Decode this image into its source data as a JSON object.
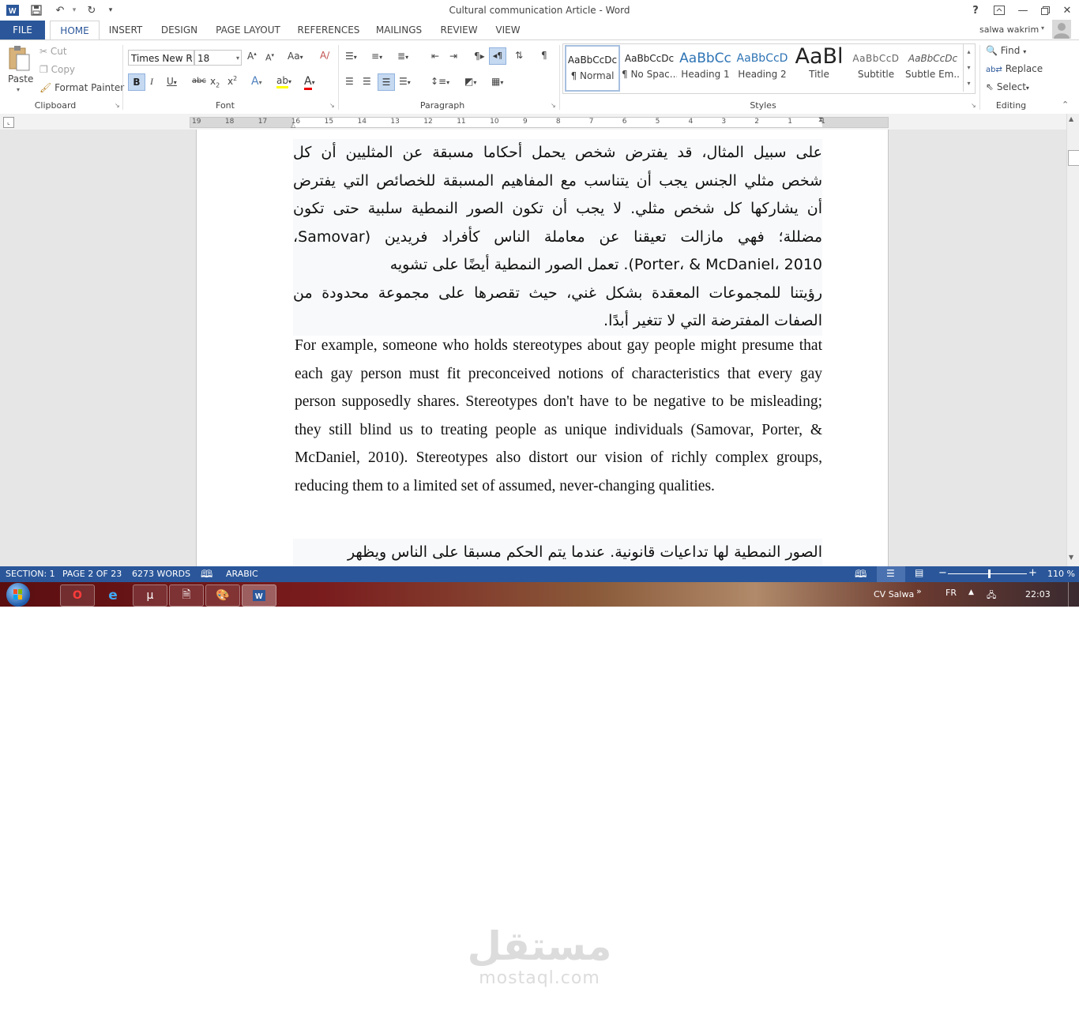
{
  "window": {
    "title": "Cultural communication Article - Word",
    "help": "?"
  },
  "quick_access": {
    "app_icon": "word-icon",
    "save_icon": "save-icon",
    "undo_icon": "undo-icon",
    "redo_icon": "redo-icon"
  },
  "tabs": [
    "FILE",
    "HOME",
    "INSERT",
    "DESIGN",
    "PAGE LAYOUT",
    "REFERENCES",
    "MAILINGS",
    "REVIEW",
    "VIEW"
  ],
  "user": "salwa wakrim",
  "ribbon": {
    "clipboard": {
      "paste": "Paste",
      "cut": "Cut",
      "copy": "Copy",
      "format_painter": "Format Painter",
      "group_label": "Clipboard"
    },
    "font": {
      "font_name": "Times New R",
      "font_size": "18",
      "group_label": "Font"
    },
    "paragraph": {
      "group_label": "Paragraph"
    },
    "styles": {
      "items": [
        {
          "sample": "AaBbCcDc",
          "name": "¶ Normal"
        },
        {
          "sample": "AaBbCcDc",
          "name": "¶ No Spac..."
        },
        {
          "sample": "AaBbCc",
          "name": "Heading 1"
        },
        {
          "sample": "AaBbCcD",
          "name": "Heading 2"
        },
        {
          "sample": "AaBl",
          "name": "Title"
        },
        {
          "sample": "AaBbCcD",
          "name": "Subtitle"
        },
        {
          "sample": "AaBbCcDc",
          "name": "Subtle Em..."
        }
      ],
      "group_label": "Styles"
    },
    "editing": {
      "find": "Find",
      "replace": "Replace",
      "select": "Select",
      "group_label": "Editing"
    }
  },
  "ruler": {
    "numbers": [
      "19",
      "18",
      "17",
      "16",
      "15",
      "14",
      "13",
      "12",
      "11",
      "10",
      "9",
      "8",
      "7",
      "6",
      "5",
      "4",
      "3",
      "2",
      "1",
      "1"
    ]
  },
  "document": {
    "arabic_paragraph_lines": [
      "على سبيل المثال، قد يفترض شخص يحمل أحكاما مسبقة عن المثليين أن كل",
      "شخص مثلي الجنس يجب أن يتناسب مع المفاهيم المسبقة للخصائص التي يفترض",
      "أن يشاركها كل شخص مثلي. لا يجب أن تكون الصور النمطية سلبية حتى تكون",
      "مضللة؛ فهي مازالت تعيقنا عن معاملة الناس كأفراد فريدين (Samovar،",
      "Porter، & McDaniel، 2010). تعمل الصور النمطية أيضًا على تشويه",
      "رؤيتنا للمجموعات المعقدة بشكل غني، حيث تقصرها على مجموعة محدودة من",
      "الصفات المفترضة التي لا تتغير أبدًا."
    ],
    "english_paragraph": "For example, someone who holds stereotypes about gay people might presume that each gay person must fit preconceived notions of characteristics that every gay person supposedly shares. Stereotypes don't have to be negative to be misleading; they still blind us to treating people as unique individuals (Samovar, Porter, & McDaniel, 2010). Stereotypes also distort our vision of richly complex groups, reducing them to a limited set of assumed, never-changing qualities.",
    "arabic_next_line": "الصور النمطية لها تداعيات قانونية. عندما يتم الحكم مسبقا على الناس ويظهر"
  },
  "status_bar": {
    "section": "SECTION: 1",
    "page": "PAGE 2 OF 23",
    "words": "6273 WORDS",
    "language": "ARABIC",
    "zoom": "110 %",
    "zoom_level_percent": 110
  },
  "taskbar": {
    "user_label": "CV Salwa",
    "language": "FR",
    "time": "22:03"
  },
  "watermark": {
    "arabic": "مستقل",
    "latin": "mostaql.com"
  },
  "colors": {
    "accent": "#2b579a",
    "doc_bg": "#e6e6e6",
    "taskbar": "#7a1c1e"
  }
}
